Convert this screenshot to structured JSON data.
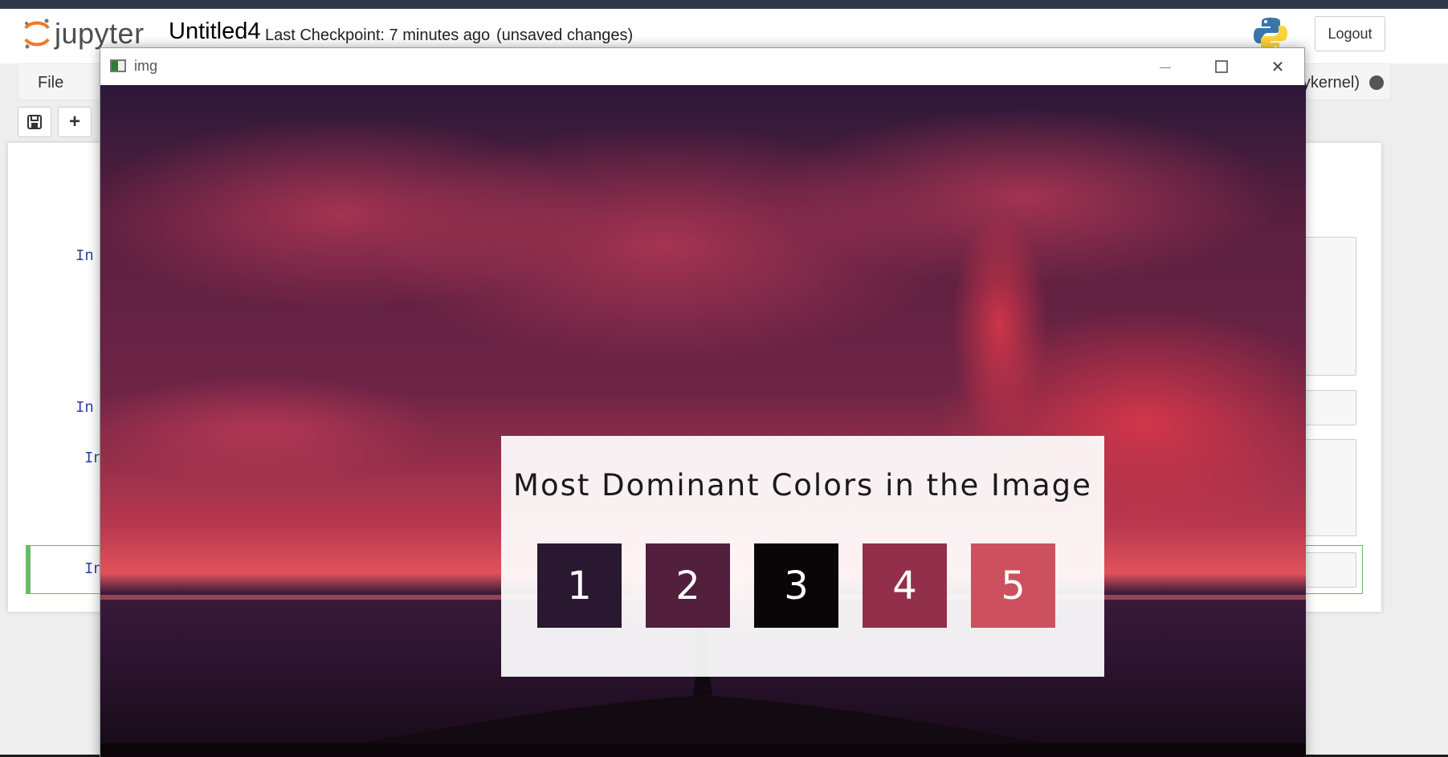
{
  "header": {
    "logo_text": "jupyter",
    "notebook_title": "Untitled4",
    "checkpoint": "Last Checkpoint: 7 minutes ago",
    "unsaved": "(unsaved changes)",
    "logout_label": "Logout"
  },
  "menubar": {
    "file_label": "File",
    "kernel_label": "ykernel)"
  },
  "toolbar": {
    "save_icon": "save-icon",
    "add_icon": "plus-icon",
    "add_symbol": "+"
  },
  "cells": {
    "prompts": [
      "In",
      "In",
      "In",
      "In"
    ]
  },
  "cv_window": {
    "title": "img",
    "minimize_symbol": "—",
    "close_symbol": "✕",
    "overlay_title": "Most Dominant Colors in the Image",
    "swatches": [
      {
        "label": "1",
        "color": "#2a1730"
      },
      {
        "label": "2",
        "color": "#521f3c"
      },
      {
        "label": "3",
        "color": "#0a0608"
      },
      {
        "label": "4",
        "color": "#92304c"
      },
      {
        "label": "5",
        "color": "#cc505e"
      }
    ]
  },
  "colors": {
    "prompt_blue": "#303f9f",
    "selected_green": "#66bb6a",
    "top_strip": "#2f3a48"
  }
}
